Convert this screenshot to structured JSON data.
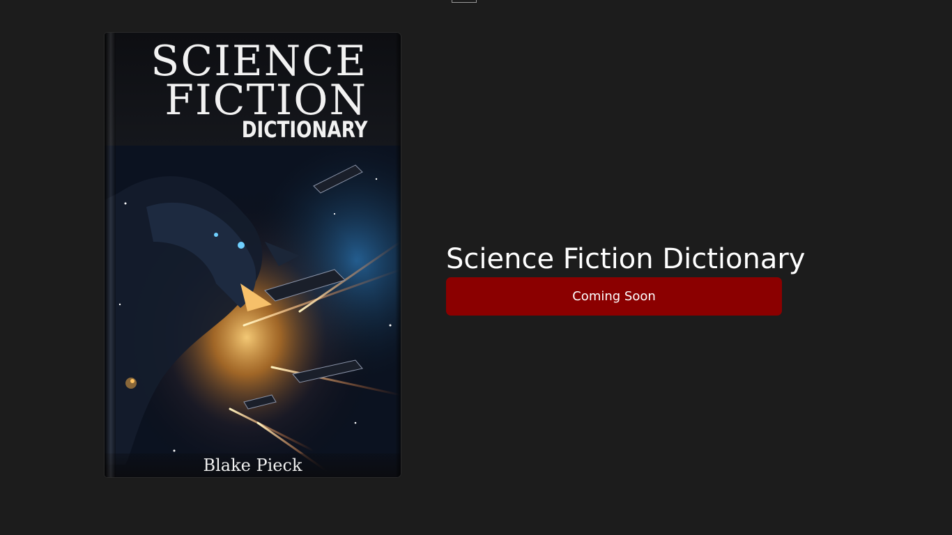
{
  "book": {
    "cover_title_line1": "SCIENCE",
    "cover_title_line2": "FICTION",
    "cover_title_line3": "DICTIONARY",
    "author": "Blake Pieck"
  },
  "product": {
    "title": "Science Fiction Dictionary",
    "status_label": "Coming Soon"
  },
  "colors": {
    "background": "#1c1c1c",
    "status_button": "#8b0000",
    "text": "#ffffff"
  }
}
